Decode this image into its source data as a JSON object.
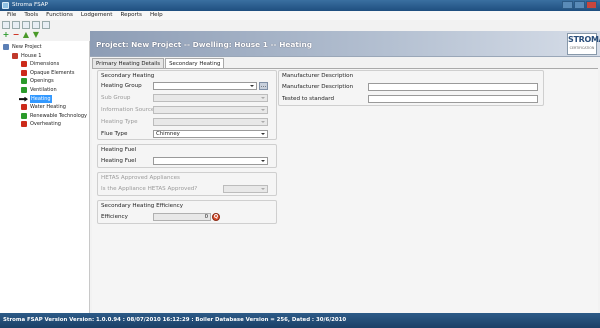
{
  "window": {
    "title": "Stroma FSAP"
  },
  "menu": [
    "File",
    "Tools",
    "Functions",
    "Lodgement",
    "Reports",
    "Help"
  ],
  "tree": {
    "project": "New Project",
    "house": "House 1",
    "items": [
      {
        "label": "Dimensions",
        "status": "error"
      },
      {
        "label": "Opaque Elements",
        "status": "error"
      },
      {
        "label": "Openings",
        "status": "ok"
      },
      {
        "label": "Ventilation",
        "status": "ok"
      },
      {
        "label": "Heating",
        "status": "current"
      },
      {
        "label": "Water Heating",
        "status": "error"
      },
      {
        "label": "Renewable Technology",
        "status": "ok"
      },
      {
        "label": "Overheating",
        "status": "error"
      }
    ]
  },
  "header": {
    "title": "Project: New Project -- Dwelling: House 1 -- Heating",
    "logo_text": "STROMA",
    "logo_sub": "CERTIFICATION"
  },
  "tabs": [
    "Primary Heating Details",
    "Secondary Heating"
  ],
  "secondary_heating": {
    "group_title": "Secondary Heating",
    "rows": [
      {
        "label": "Heating Group",
        "value": "",
        "disabled": false
      },
      {
        "label": "Sub Group",
        "value": "",
        "disabled": true
      },
      {
        "label": "Information Source",
        "value": "",
        "disabled": true
      },
      {
        "label": "Heating Type",
        "value": "",
        "disabled": true
      },
      {
        "label": "Flue Type",
        "value": "Chimney",
        "disabled": false
      }
    ],
    "side_button": "..."
  },
  "heating_fuel": {
    "group_title": "Heating Fuel",
    "label": "Heating Fuel",
    "value": ""
  },
  "hetas": {
    "group_title": "HETAS Approved Appliances",
    "label": "Is the Appliance HETAS Approved?",
    "value": ""
  },
  "efficiency": {
    "group_title": "Secondary Heating Efficiency",
    "label": "Efficiency",
    "value": "0",
    "button": "Q"
  },
  "manufacturer": {
    "group_title": "Manufacturer Description",
    "fields": [
      {
        "label": "Manufacturer Description",
        "value": ""
      },
      {
        "label": "Tested to standard",
        "value": ""
      }
    ]
  },
  "statusbar": {
    "text": "Stroma FSAP Version Version: 1.0.0.94  :  08/07/2010 16:12:29  :  Boiler Database Version = 256, Dated : 30/6/2010"
  },
  "colors": {
    "error": "#cc2a1a",
    "ok": "#2a9a2a",
    "current": "#3399ff"
  }
}
